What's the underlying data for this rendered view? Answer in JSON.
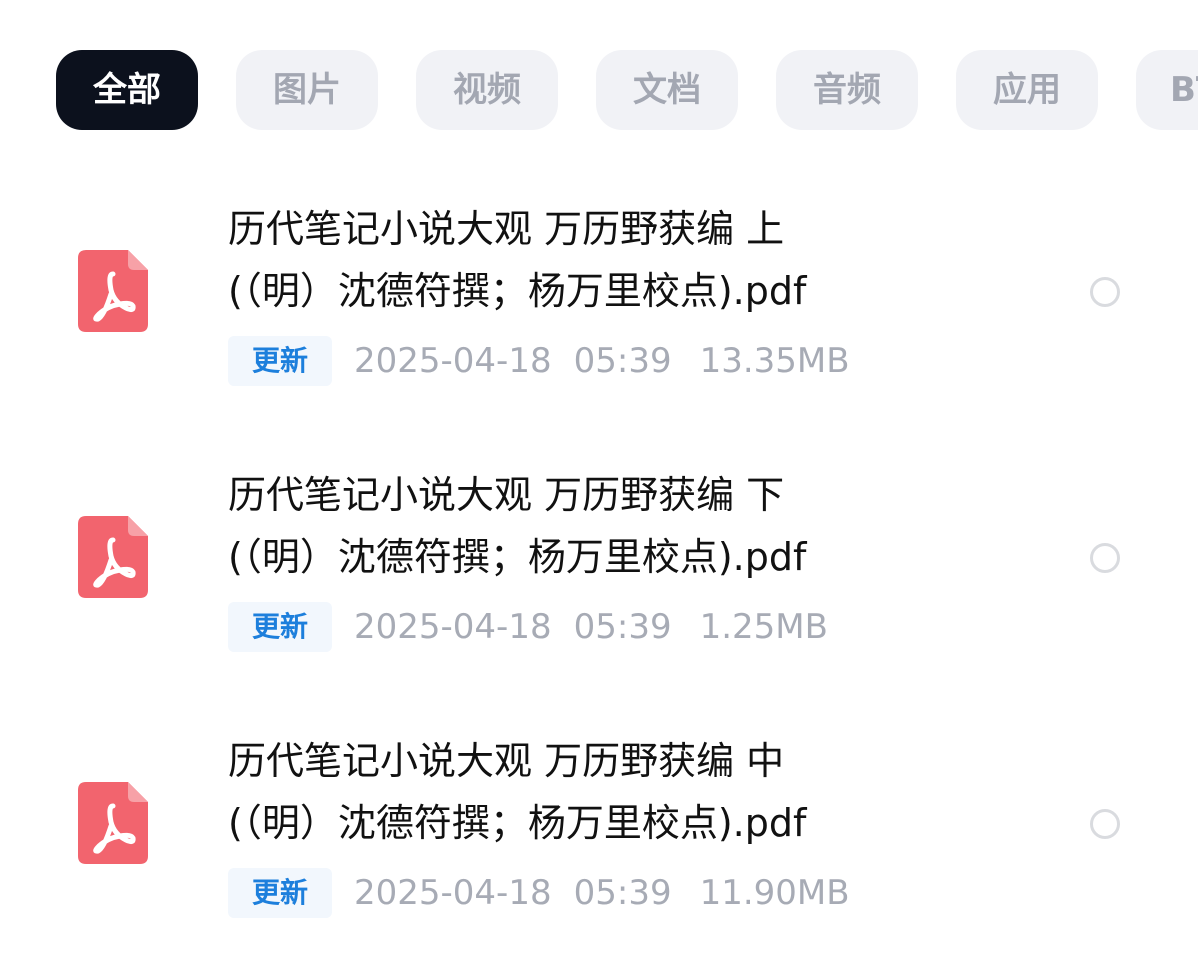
{
  "tabs": [
    {
      "label": "全部",
      "active": true
    },
    {
      "label": "图片",
      "active": false
    },
    {
      "label": "视频",
      "active": false
    },
    {
      "label": "文档",
      "active": false
    },
    {
      "label": "音频",
      "active": false
    },
    {
      "label": "应用",
      "active": false
    },
    {
      "label": "BT",
      "active": false
    }
  ],
  "files": [
    {
      "icon": "pdf-file-icon",
      "title_line1": "历代笔记小说大观 万历野获编 上",
      "title_line2": "(（明）沈德符撰；杨万里校点).pdf",
      "badge": "更新",
      "date": "2025-04-18",
      "time": "05:39",
      "size": "13.35MB",
      "selected": false
    },
    {
      "icon": "pdf-file-icon",
      "title_line1": "历代笔记小说大观 万历野获编 下",
      "title_line2": "(（明）沈德符撰；杨万里校点).pdf",
      "badge": "更新",
      "date": "2025-04-18",
      "time": "05:39",
      "size": "1.25MB",
      "selected": false
    },
    {
      "icon": "pdf-file-icon",
      "title_line1": "历代笔记小说大观 万历野获编 中",
      "title_line2": "(（明）沈德符撰；杨万里校点).pdf",
      "badge": "更新",
      "date": "2025-04-18",
      "time": "05:39",
      "size": "11.90MB",
      "selected": false
    }
  ],
  "colors": {
    "active_tab_bg": "#0c111d",
    "tab_bg": "#f1f2f6",
    "badge_text": "#1d7fdc",
    "pdf_icon": "#f2646e"
  }
}
